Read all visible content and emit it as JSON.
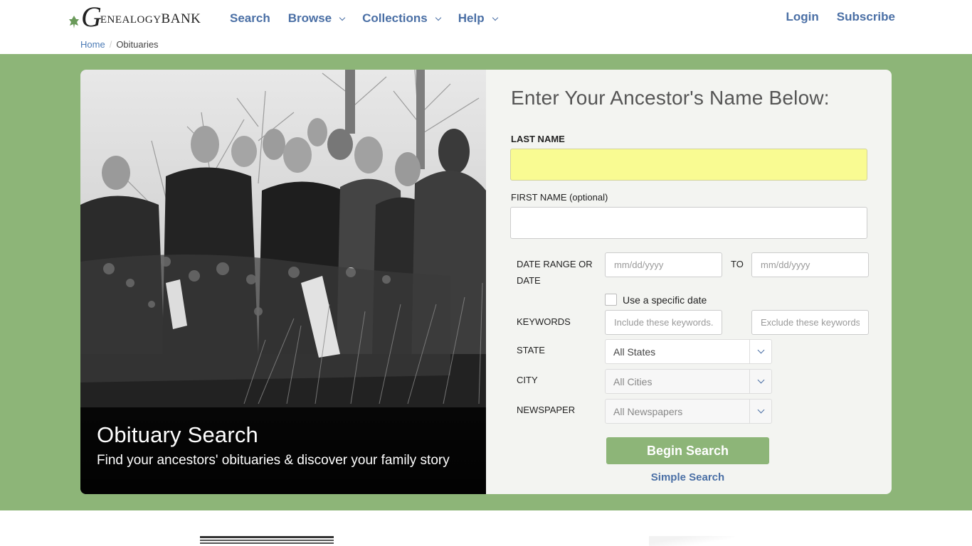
{
  "header": {
    "logo": {
      "initial": "G",
      "word_main": "ENEALOGY",
      "word_second": "BANK",
      "alt": "GenealogyBank"
    },
    "nav": [
      {
        "label": "Search",
        "has_dropdown": false
      },
      {
        "label": "Browse",
        "has_dropdown": true
      },
      {
        "label": "Collections",
        "has_dropdown": true
      },
      {
        "label": "Help",
        "has_dropdown": true
      }
    ],
    "auth": {
      "login": "Login",
      "subscribe": "Subscribe"
    },
    "breadcrumb": {
      "home": "Home",
      "separator": "/",
      "current": "Obituaries"
    }
  },
  "hero": {
    "title": "Obituary Search",
    "subtitle": "Find your ancestors' obituaries & discover your family story",
    "accent_color": "#8db578"
  },
  "form": {
    "heading": "Enter Your Ancestor's Name Below:",
    "last_name": {
      "label": "LAST NAME",
      "value": ""
    },
    "first_name": {
      "label": "FIRST NAME (optional)",
      "value": ""
    },
    "date_range": {
      "label": "DATE RANGE OR DATE",
      "from_placeholder": "mm/dd/yyyy",
      "to_label": "TO",
      "to_placeholder": "mm/dd/yyyy",
      "specific_date_label": "Use a specific date",
      "specific_date_checked": false
    },
    "keywords": {
      "label": "KEYWORDS",
      "include_placeholder": "Include these keywords.",
      "exclude_placeholder": "Exclude these keywords."
    },
    "state": {
      "label": "STATE",
      "value": "All States"
    },
    "city": {
      "label": "CITY",
      "value": "All Cities"
    },
    "newspaper": {
      "label": "NEWSPAPER",
      "value": "All Newspapers"
    },
    "submit_label": "Begin Search",
    "simple_search_label": "Simple Search"
  }
}
